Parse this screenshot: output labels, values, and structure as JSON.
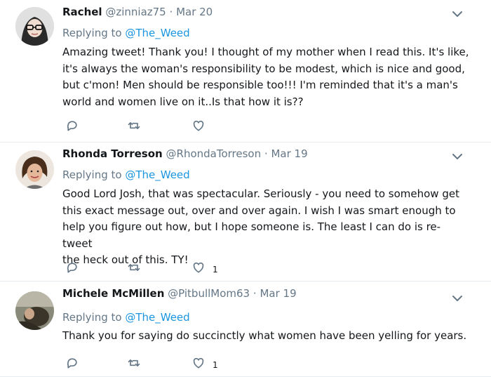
{
  "tweets": [
    {
      "name": "Rachel",
      "handle": "@zinniaz75",
      "sep": "·",
      "date": "Mar 20",
      "replying_prefix": "Replying to ",
      "replying_to": "@The_Weed",
      "text": "Amazing tweet! Thank you! I thought of my mother when I read this. It's like,\nit's always the woman's responsibility to be modest, which is nice and good,\nbut c'mon! Men should be responsible too!!!  I'm reminded that it's a man's\nworld and women live on it..Is that how it is??",
      "like_count": ""
    },
    {
      "name": "Rhonda Torreson",
      "handle": "@RhondaTorreson",
      "sep": "·",
      "date": "Mar 19",
      "replying_prefix": "Replying to ",
      "replying_to": "@The_Weed",
      "text": "Good Lord Josh, that was spectacular. Seriously - you need to somehow get\nthis exact message out, over and over again. I wish I was smart enough to\nhelp you figure out how, but I hope someone is. The least I can do is re-tweet\nthe heck out of this. TY!",
      "like_count": "1"
    },
    {
      "name": "Michele McMillen",
      "handle": "@PitbullMom63",
      "sep": "·",
      "date": "Mar 19",
      "replying_prefix": "Replying to ",
      "replying_to": "@The_Weed",
      "text": "Thank you for saying do succinctly what women have been yelling for years.",
      "like_count": "1"
    }
  ],
  "icons": {
    "reply": "reply-icon",
    "retweet": "retweet-icon",
    "like": "like-icon",
    "more": "chevron-down-icon"
  },
  "colors": {
    "link": "#1b95e0",
    "secondary_text": "#657786",
    "icon": "#657786"
  }
}
